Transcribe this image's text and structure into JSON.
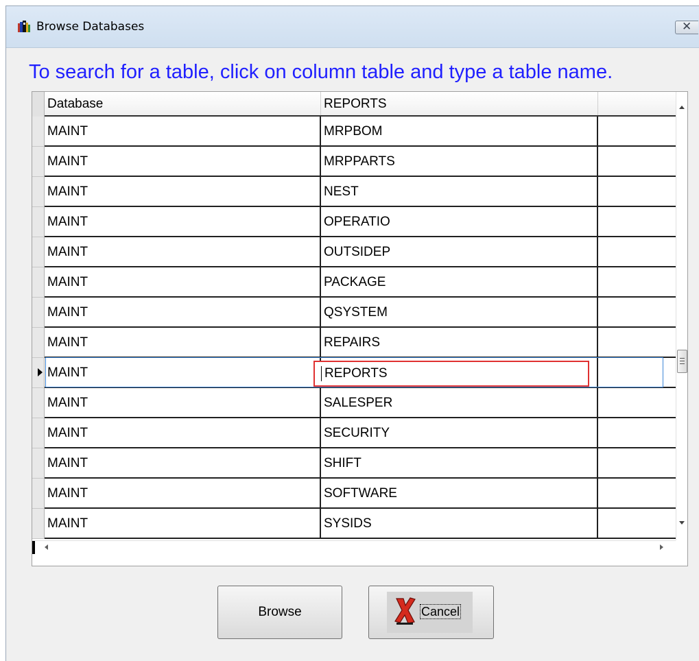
{
  "window": {
    "title": "Browse Databases",
    "close_glyph": "✕",
    "app_icon": "db-app-icon"
  },
  "instruction": "To search for a table, click on column table and type a table name.",
  "grid": {
    "columns": [
      "Database",
      "REPORTS"
    ],
    "rows": [
      {
        "database": "MAINT",
        "table": "MRPBOM"
      },
      {
        "database": "MAINT",
        "table": "MRPPARTS"
      },
      {
        "database": "MAINT",
        "table": "NEST"
      },
      {
        "database": "MAINT",
        "table": "OPERATIO"
      },
      {
        "database": "MAINT",
        "table": "OUTSIDEP"
      },
      {
        "database": "MAINT",
        "table": "PACKAGE"
      },
      {
        "database": "MAINT",
        "table": "QSYSTEM"
      },
      {
        "database": "MAINT",
        "table": "REPAIRS"
      },
      {
        "database": "MAINT",
        "table": "REPORTS",
        "current": true
      },
      {
        "database": "MAINT",
        "table": "SALESPER"
      },
      {
        "database": "MAINT",
        "table": "SECURITY"
      },
      {
        "database": "MAINT",
        "table": "SHIFT"
      },
      {
        "database": "MAINT",
        "table": "SOFTWARE"
      },
      {
        "database": "MAINT",
        "table": "SYSIDS"
      }
    ],
    "highlight_color": "#e03030",
    "focus_color": "#3d86d8"
  },
  "buttons": {
    "browse": "Browse",
    "cancel": "Cancel"
  },
  "colors": {
    "instruction_text": "#1f1fff",
    "dialog_background": "#f0f0f0"
  }
}
